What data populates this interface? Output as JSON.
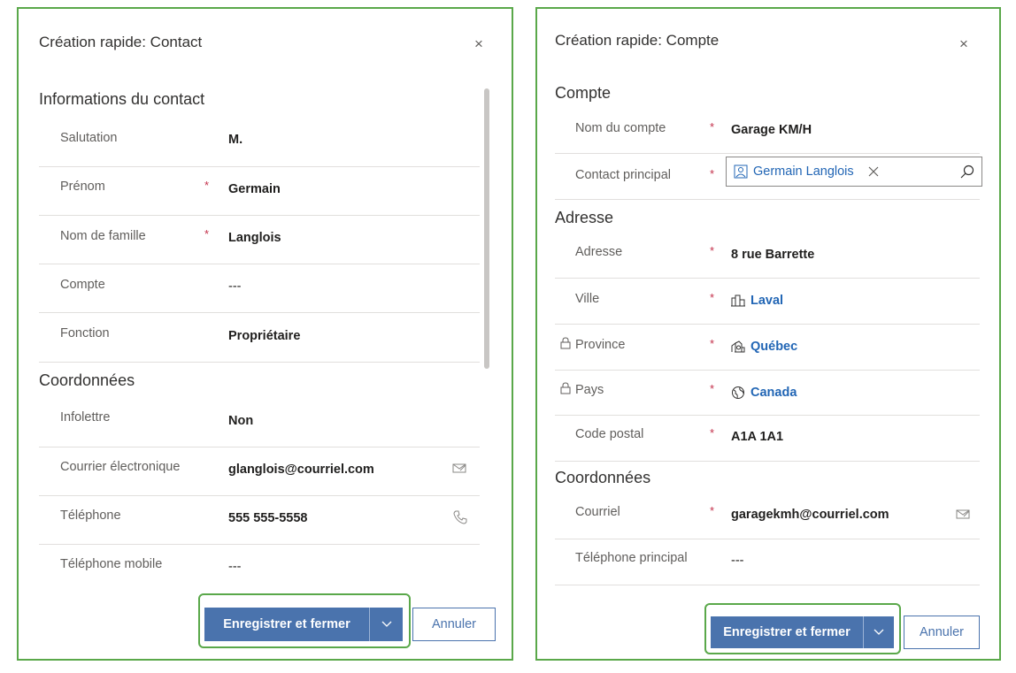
{
  "contact_form": {
    "title": "Création rapide: Contact",
    "close_glyph": "×",
    "sections": {
      "info": "Informations du contact",
      "coords": "Coordonnées"
    },
    "fields": {
      "salutation": {
        "label": "Salutation",
        "value": "M."
      },
      "prenom": {
        "label": "Prénom",
        "value": "Germain"
      },
      "nom": {
        "label": "Nom de famille",
        "value": "Langlois"
      },
      "compte": {
        "label": "Compte",
        "value": "---"
      },
      "fonction": {
        "label": "Fonction",
        "value": "Propriétaire"
      },
      "infolettre": {
        "label": "Infolettre",
        "value": "Non"
      },
      "courriel": {
        "label": "Courrier électronique",
        "value": "glanglois@courriel.com"
      },
      "telephone": {
        "label": "Téléphone",
        "value": "555 555-5558"
      },
      "mobile": {
        "label": "Téléphone mobile",
        "value": "---"
      }
    },
    "required_marker": "*",
    "save_label": "Enregistrer et fermer",
    "cancel_label": "Annuler"
  },
  "account_form": {
    "title": "Création rapide: Compte",
    "close_glyph": "×",
    "sections": {
      "compte": "Compte",
      "adresse": "Adresse",
      "coords": "Coordonnées"
    },
    "fields": {
      "nom_compte": {
        "label": "Nom du compte",
        "value": "Garage KM/H"
      },
      "contact_principal": {
        "label": "Contact principal",
        "value": "Germain Langlois"
      },
      "adresse": {
        "label": "Adresse",
        "value": "8 rue Barrette"
      },
      "ville": {
        "label": "Ville",
        "value": "Laval"
      },
      "province": {
        "label": "Province",
        "value": "Québec"
      },
      "pays": {
        "label": "Pays",
        "value": "Canada"
      },
      "code_postal": {
        "label": "Code postal",
        "value": "A1A 1A1"
      },
      "courriel": {
        "label": "Courriel",
        "value": "garagekmh@courriel.com"
      },
      "telephone": {
        "label": "Téléphone principal",
        "value": "---"
      }
    },
    "required_marker": "*",
    "save_label": "Enregistrer et fermer",
    "cancel_label": "Annuler"
  },
  "colors": {
    "highlight": "#5aa84a",
    "primary": "#4a73ad",
    "link": "#2266b5",
    "required": "#c4314b"
  },
  "icons": [
    "close-icon",
    "email-icon",
    "phone-icon",
    "contact-icon",
    "search-icon",
    "remove-icon",
    "city-icon",
    "province-icon",
    "globe-icon",
    "lock-icon",
    "chevron-down-icon"
  ]
}
